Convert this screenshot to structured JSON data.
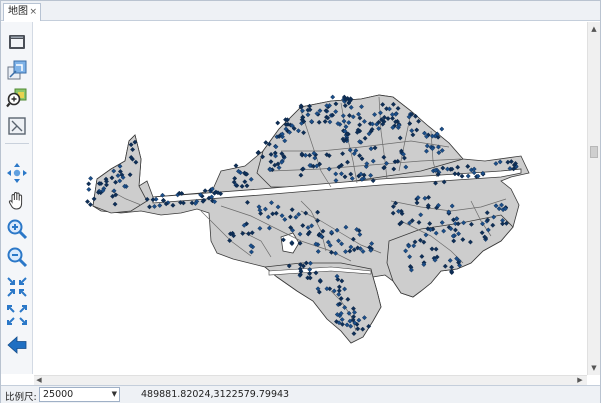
{
  "tab": {
    "label": "地图",
    "close_glyph": "×"
  },
  "toolbar": {
    "tools": [
      {
        "name": "layer-panel-icon"
      },
      {
        "name": "full-extent-icon"
      },
      {
        "name": "zoom-to-layer-icon"
      },
      {
        "name": "select-icon"
      },
      {
        "name": "pan-arrows-icon"
      },
      {
        "name": "hand-pan-icon"
      },
      {
        "name": "zoom-in-icon"
      },
      {
        "name": "zoom-out-icon"
      },
      {
        "name": "fixed-zoom-in-icon"
      },
      {
        "name": "fixed-zoom-out-icon"
      },
      {
        "name": "back-arrow-icon"
      }
    ]
  },
  "map": {
    "fill_color": "#cdcdcd",
    "stroke_color": "#3a3a3a",
    "road_color": "#6b6b6b",
    "node_color": "#1b4f8a",
    "node_dark_color": "#0e2f57"
  },
  "statusbar": {
    "scale_label": "比例尺:",
    "scale_value": "25000",
    "coordinates": "489881.82024,3122579.79943"
  }
}
